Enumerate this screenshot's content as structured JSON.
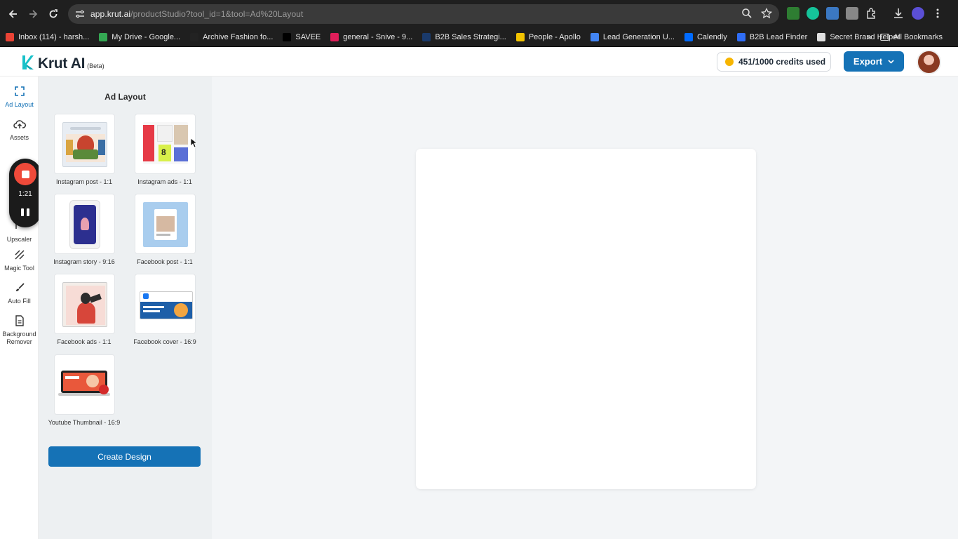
{
  "browser": {
    "url_host": "app.krut.ai",
    "url_path": "/productStudio?tool_id=1&tool=Ad%20Layout",
    "bookmarks": [
      {
        "label": "Inbox (114) - harsh...",
        "icon": "gmail-icon",
        "color": "#ea4335"
      },
      {
        "label": "My Drive - Google...",
        "icon": "google-drive-icon",
        "color": "#34a853"
      },
      {
        "label": "Archive Fashion fo...",
        "icon": "amazon-icon",
        "color": "#222222"
      },
      {
        "label": "SAVEE",
        "icon": "savee-icon",
        "color": "#000000"
      },
      {
        "label": "general - Snive - 9...",
        "icon": "slack-icon",
        "color": "#e01e5a"
      },
      {
        "label": "B2B Sales Strategi...",
        "icon": "globe-icon",
        "color": "#1a3a6b"
      },
      {
        "label": "People - Apollo",
        "icon": "apollo-icon",
        "color": "#f2c300"
      },
      {
        "label": "Lead Generation U...",
        "icon": "docs-icon",
        "color": "#4285f4"
      },
      {
        "label": "Calendly",
        "icon": "calendly-icon",
        "color": "#006bff"
      },
      {
        "label": "B2B Lead Finder",
        "icon": "bolt-icon",
        "color": "#2f6df6"
      },
      {
        "label": "Secret Brand Helper",
        "icon": "openai-icon",
        "color": "#e0e0e0"
      }
    ],
    "more_bookmarks": "»",
    "all_bookmarks": "All Bookmarks"
  },
  "header": {
    "logo": "Krut AI",
    "beta": "(Beta)",
    "credits": "451/1000 credits used",
    "export": "Export"
  },
  "rail": {
    "items": [
      {
        "label": "Ad Layout",
        "icon": "expand-icon"
      },
      {
        "label": "Assets",
        "icon": "cloud-upload-icon"
      },
      {
        "label": "Upscaler",
        "icon": "upscale-icon"
      },
      {
        "label": "Magic Tool",
        "icon": "magic-wand-icon"
      },
      {
        "label": "Auto Fill",
        "icon": "brush-icon"
      },
      {
        "label": "Background Remover",
        "icon": "file-icon"
      }
    ]
  },
  "recorder": {
    "time": "1:21"
  },
  "panel": {
    "title": "Ad Layout",
    "layouts": [
      {
        "label": "Instagram post - 1:1"
      },
      {
        "label": "Instagram ads - 1:1"
      },
      {
        "label": "Instagram story - 9:16"
      },
      {
        "label": "Facebook post - 1:1"
      },
      {
        "label": "Facebook ads - 1:1"
      },
      {
        "label": "Facebook cover - 16:9"
      },
      {
        "label": "Youtube Thumbnail - 16:9"
      }
    ],
    "create_button": "Create Design"
  },
  "colors": {
    "accent": "#1572b6",
    "brand": "#18c1c9",
    "record": "#ef4a3a",
    "coin": "#f7b500"
  }
}
